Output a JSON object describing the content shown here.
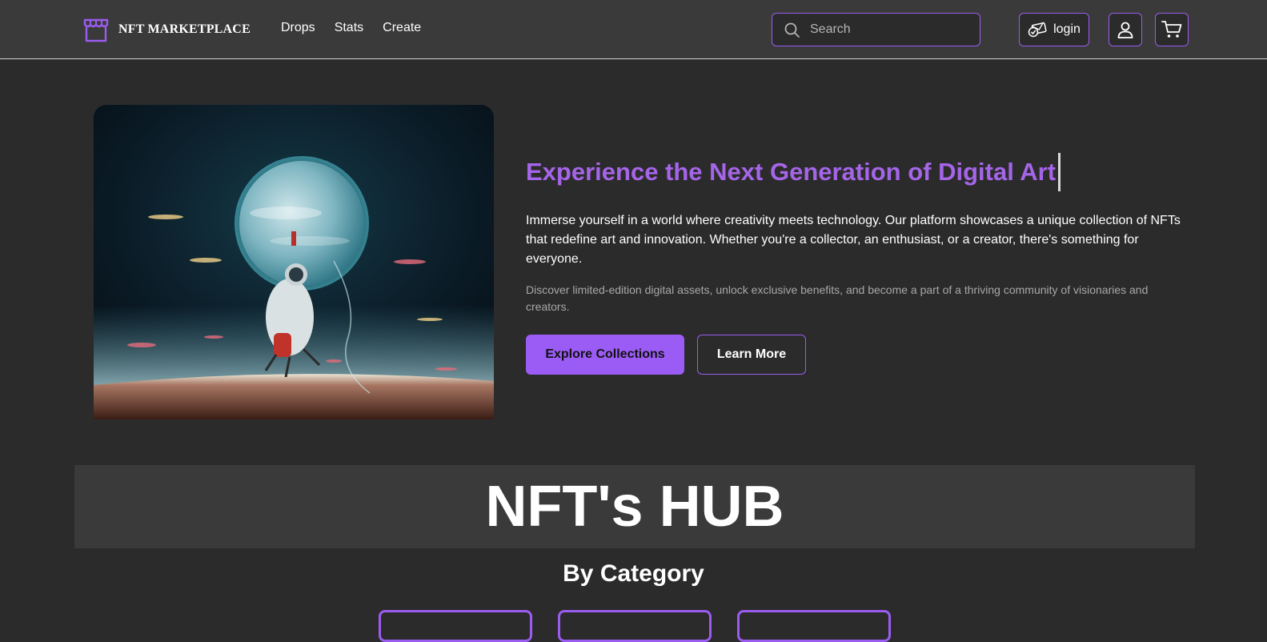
{
  "navbar": {
    "brand_name": "NFT MARKETPLACE",
    "brand_icon": "storefront-icon",
    "links": [
      "Drops",
      "Stats",
      "Create"
    ],
    "search": {
      "placeholder": "Search",
      "value": "",
      "icon": "search-icon"
    },
    "login_label": "login",
    "login_icon": "wallet-icon",
    "user_icon": "user-icon",
    "cart_icon": "cart-icon"
  },
  "hero": {
    "title": "Experience the Next Generation of Digital Art",
    "description": "Immerse yourself in a world where creativity meets technology. Our platform showcases a unique collection of NFTs that redefine art and innovation. Whether you're a collector, an enthusiast, or a creator, there's something for everyone.",
    "subtext": "Discover limited-edition digital assets, unlock exclusive benefits, and become a part of a thriving community of visionaries and creators.",
    "primary_button": "Explore Collections",
    "secondary_button": "Learn More"
  },
  "hub": {
    "title": "NFT's HUB",
    "category_heading": "By Category"
  },
  "colors": {
    "accent": "#9b5cf6",
    "title_purple": "#a565e8",
    "background": "#2b2b2b",
    "panel": "#3a3a3a"
  }
}
